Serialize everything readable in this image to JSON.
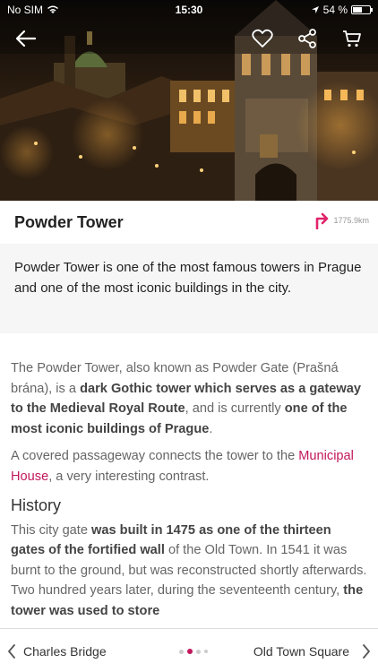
{
  "status_bar": {
    "carrier": "No SIM",
    "time": "15:30",
    "battery_percent": "54 %",
    "battery_level": 0.54
  },
  "header": {
    "back_icon": "arrow-left-icon",
    "favorite_icon": "heart-icon",
    "share_icon": "share-icon",
    "cart_icon": "cart-icon"
  },
  "place": {
    "title": "Powder Tower",
    "distance": "1775.9km"
  },
  "intro": "Powder Tower is one of the most famous towers in Prague and one of the most iconic buildings in the city.",
  "body": {
    "p1_a": "The Powder Tower, also known as Powder Gate (Prašná brána), is a ",
    "p1_b": "dark Gothic tower which serves as a gateway to the Medieval Royal Route",
    "p1_c": ", and is currently ",
    "p1_d": "one of the most iconic buildings of Prague",
    "p1_e": ".",
    "p2_a": "A covered passageway connects the tower to the ",
    "p2_link": "Municipal House",
    "p2_b": ", a very interesting contrast.",
    "history_heading": "History",
    "p3_a": "This city gate ",
    "p3_b": "was built in 1475 as one of the thirteen gates of the fortified wall",
    "p3_c": " of the Old Town. In 1541 it was burnt to the ground, but was reconstructed shortly afterwards. Two hundred years later, during the seventeenth century, ",
    "p3_d": "the tower was used to store"
  },
  "bottom_nav": {
    "prev_label": "Charles Bridge",
    "next_label": "Old Town Square",
    "accent": "#c2185b"
  }
}
